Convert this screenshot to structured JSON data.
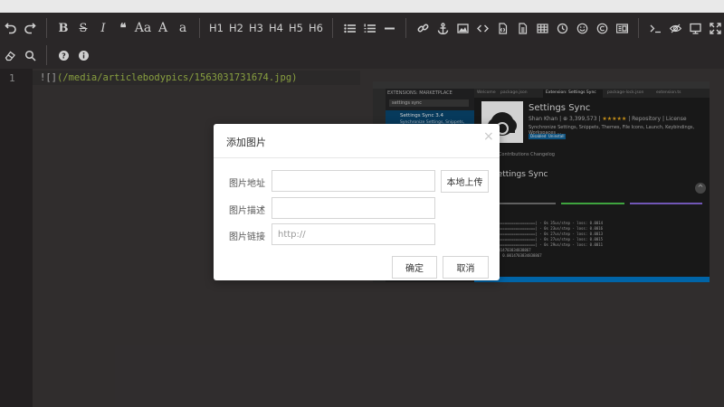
{
  "toolbar": {
    "row1": [
      {
        "name": "undo-icon",
        "kind": "icon"
      },
      {
        "name": "redo-icon",
        "kind": "icon"
      },
      {
        "kind": "sep"
      },
      {
        "name": "bold-button",
        "label": "B",
        "style": "bold"
      },
      {
        "name": "strikethrough-button",
        "label": "S",
        "style": "strike"
      },
      {
        "name": "italic-button",
        "label": "I",
        "style": "italic"
      },
      {
        "name": "quote-icon",
        "label": "❝",
        "style": "bold"
      },
      {
        "name": "uppercase-button",
        "label": "Aa",
        "style": "normal"
      },
      {
        "name": "font-size-up-button",
        "label": "A",
        "style": "normal"
      },
      {
        "name": "lowercase-button",
        "label": "a",
        "style": "normal"
      },
      {
        "kind": "sep"
      },
      {
        "name": "h1-button",
        "label": "H1"
      },
      {
        "name": "h2-button",
        "label": "H2"
      },
      {
        "name": "h3-button",
        "label": "H3"
      },
      {
        "name": "h4-button",
        "label": "H4"
      },
      {
        "name": "h5-button",
        "label": "H5"
      },
      {
        "name": "h6-button",
        "label": "H6"
      },
      {
        "kind": "sep"
      },
      {
        "name": "unordered-list-icon",
        "kind": "icon"
      },
      {
        "name": "ordered-list-icon",
        "kind": "icon"
      },
      {
        "name": "horizontal-rule-icon",
        "kind": "icon"
      },
      {
        "kind": "sep"
      },
      {
        "name": "link-icon",
        "kind": "icon"
      },
      {
        "name": "anchor-icon",
        "kind": "icon"
      },
      {
        "name": "image-icon",
        "kind": "icon"
      },
      {
        "name": "code-icon",
        "kind": "icon"
      },
      {
        "name": "code-block-icon",
        "kind": "icon"
      },
      {
        "name": "code-file-icon",
        "kind": "icon"
      },
      {
        "name": "table-icon",
        "kind": "icon"
      },
      {
        "name": "datetime-icon",
        "kind": "icon"
      },
      {
        "name": "emoji-icon",
        "kind": "icon"
      },
      {
        "name": "html-entities-icon",
        "kind": "icon"
      },
      {
        "name": "pagebreak-icon",
        "kind": "icon"
      },
      {
        "kind": "sep"
      },
      {
        "name": "goto-line-icon",
        "kind": "icon"
      },
      {
        "name": "watch-icon",
        "kind": "icon"
      },
      {
        "name": "preview-icon",
        "kind": "icon"
      },
      {
        "name": "fullscreen-icon",
        "kind": "icon"
      }
    ],
    "row2": [
      {
        "name": "clear-icon",
        "kind": "icon"
      },
      {
        "name": "search-icon",
        "kind": "icon"
      },
      {
        "kind": "sep"
      },
      {
        "name": "help-icon",
        "kind": "icon"
      },
      {
        "name": "info-icon",
        "kind": "icon"
      }
    ]
  },
  "editor": {
    "line_number": "1",
    "line_prefix": "![]",
    "line_link": "(/media/articlebodypics/1563031731674.jpg)"
  },
  "preview": {
    "sidebar_header": "EXTENSIONS: MARKETPLACE",
    "search_value": "settings sync",
    "item_title": "Settings Sync 3.4",
    "item_sub": "Synchronize Settings, Snippets, Theme...",
    "tabs": [
      "Welcome",
      "package.json",
      "Extension: Settings Sync",
      "package-lock.json",
      "extension.ts"
    ],
    "ext_title": "Settings Sync",
    "ext_author": "Shan Khan",
    "ext_installs": "| ⊕ 3,399,573 |",
    "ext_stars": "★★★★★",
    "ext_repo": "| Repository | License",
    "ext_desc": "Synchronize Settings, Snippets, Themes, File Icons, Launch, Keybindings, Workspaces ...",
    "ext_chip1": "Disabled",
    "ext_chip2": "Uninstall",
    "ext_tabrow": "Details    Contributions    Changelog",
    "ext_readme_title": "Settings Sync",
    "term_lines": [
      "                                     ",
      "       |====================| - 0s 35us/step - loss: 0.0014",
      "       |====================| - 0s 23us/step - loss: 0.0016",
      "       |====================| - 0s 27us/step - loss: 0.0013",
      "       |====================| - 0s 27us/step - loss: 0.0015",
      "       |====================| - 0s 29us/step - loss: 0.0011",
      "  loss: 0.0014703834838867",
      "  Test loss: 0.0014703834838867"
    ]
  },
  "dialog": {
    "title": "添加图片",
    "close": "×",
    "label_url": "图片地址",
    "label_desc": "图片描述",
    "label_link": "图片链接",
    "upload_button": "本地上传",
    "link_placeholder": "http://",
    "ok_button": "确定",
    "cancel_button": "取消"
  },
  "colors": {
    "toolbar_bg": "#2a2728",
    "editor_bg": "#3b3738",
    "gutter_bg": "#2b2829",
    "link_green": "#a6c24e"
  }
}
